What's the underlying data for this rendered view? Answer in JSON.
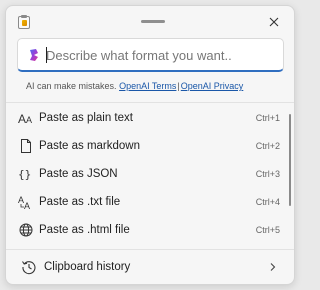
{
  "prompt": {
    "placeholder": "Describe what format you want..",
    "value": ""
  },
  "disclaimer": {
    "text": "AI can make mistakes.",
    "terms_link": "OpenAI Terms",
    "separator": "|",
    "privacy_link": "OpenAI Privacy"
  },
  "menu": {
    "items": [
      {
        "label": "Paste as plain text",
        "shortcut": "Ctrl+1",
        "icon": "font-size-icon"
      },
      {
        "label": "Paste as markdown",
        "shortcut": "Ctrl+2",
        "icon": "document-icon"
      },
      {
        "label": "Paste as JSON",
        "shortcut": "Ctrl+3",
        "icon": "braces-icon"
      },
      {
        "label": "Paste as .txt file",
        "shortcut": "Ctrl+4",
        "icon": "text-file-icon"
      },
      {
        "label": "Paste as .html file",
        "shortcut": "Ctrl+5",
        "icon": "globe-icon"
      }
    ]
  },
  "footer": {
    "label": "Clipboard history",
    "icon": "history-icon"
  },
  "colors": {
    "accent": "#2f6ec0",
    "link": "#1a57a8",
    "background": "#f6f6f6"
  }
}
